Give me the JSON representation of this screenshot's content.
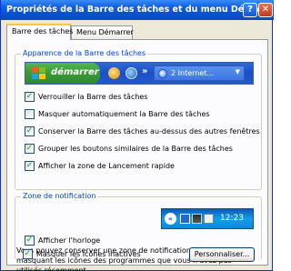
{
  "window": {
    "title": "Propriétés de la Barre des tâches et du menu Démarrer",
    "help_glyph": "?",
    "close_glyph": "✕"
  },
  "tabs": [
    {
      "label": "Barre des tâches",
      "active": true
    },
    {
      "label": "Menu Démarrer",
      "active": false
    }
  ],
  "appearance": {
    "group_label": "Apparence de la Barre des tâches",
    "start_label": "démarrer",
    "taskbar_button_label": "2 Internet...",
    "quick_launch_chevron": "»",
    "icons": [
      "windows-logo-icon",
      "quick-launch-icon",
      "ie-icon",
      "internet-explorer-icon"
    ],
    "options": [
      {
        "label": "Verrouiller la Barre des tâches",
        "checked": true
      },
      {
        "label": "Masquer automatiquement la Barre des tâches",
        "checked": false
      },
      {
        "label": "Conserver la Barre des tâches au-dessus des autres fenêtres",
        "checked": true
      },
      {
        "label": "Grouper les boutons similaires de la Barre des tâches",
        "checked": true
      },
      {
        "label": "Afficher la zone de Lancement rapide",
        "checked": true
      }
    ]
  },
  "notification": {
    "group_label": "Zone de notification",
    "tray_chevron": "«",
    "clock": "12:23",
    "show_clock": {
      "label": "Afficher l'horloge",
      "checked": true
    },
    "description": "Vous pouvez conserver une zone de notification claire en masquant les icônes des programmes que vous n'avez pas utilisés récemment.",
    "hide_inactive": {
      "label": "Masquer les icônes inactives",
      "checked": true
    },
    "customize_label": "Personnaliser..."
  },
  "colors": {
    "title_bar": "#0a4fd0",
    "group_label": "#0046d5",
    "start_button": "#3c9c39",
    "taskbar": "#1a4fc7",
    "tray": "#139ee9",
    "checkmark": "#21a121",
    "panel": "#fcfcfe"
  }
}
